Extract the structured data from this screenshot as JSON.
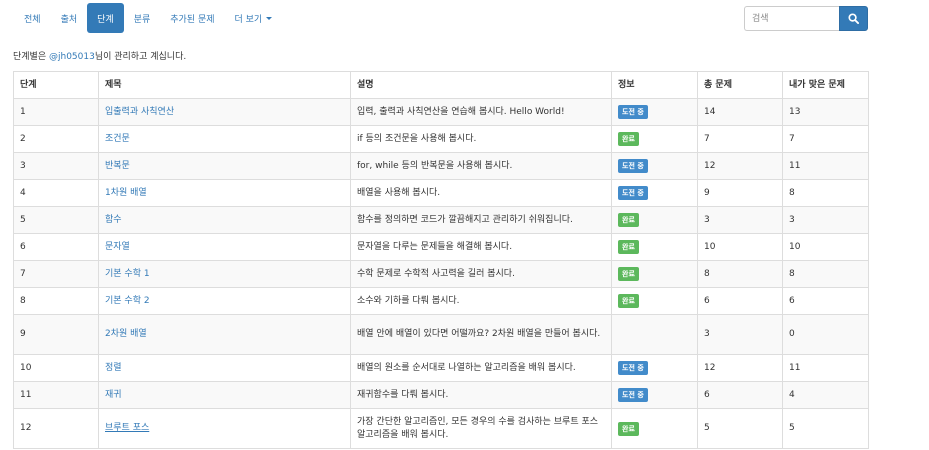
{
  "nav": {
    "items": [
      "전체",
      "출처",
      "단계",
      "분류",
      "추가된 문제",
      "더 보기"
    ]
  },
  "search": {
    "placeholder": "검색",
    "icon": "search-icon"
  },
  "subtitle": {
    "prefix": "단계별은 ",
    "user": "@jh05013",
    "suffix": "님이 관리하고 계십니다."
  },
  "colors": {
    "primary": "#337ab7",
    "in_progress": "#428bca",
    "done": "#5cb85c"
  },
  "table": {
    "headers": [
      "단계",
      "제목",
      "설명",
      "정보",
      "총 문제",
      "내가 맞은 문제"
    ],
    "rows": [
      {
        "step": "1",
        "title": "입출력과 사칙연산",
        "desc": "입력, 출력과 사칙연산을 연습해 봅시다. Hello World!",
        "status": "도전 중",
        "total": "14",
        "solved": "13"
      },
      {
        "step": "2",
        "title": "조건문",
        "desc": "if 등의 조건문을 사용해 봅시다.",
        "status": "완료",
        "total": "7",
        "solved": "7"
      },
      {
        "step": "3",
        "title": "반복문",
        "desc": "for, while 등의 반복문을 사용해 봅시다.",
        "status": "도전 중",
        "total": "12",
        "solved": "11"
      },
      {
        "step": "4",
        "title": "1차원 배열",
        "desc": "배열을 사용해 봅시다.",
        "status": "도전 중",
        "total": "9",
        "solved": "8"
      },
      {
        "step": "5",
        "title": "함수",
        "desc": "함수를 정의하면 코드가 깔끔해지고 관리하기 쉬워집니다.",
        "status": "완료",
        "total": "3",
        "solved": "3"
      },
      {
        "step": "6",
        "title": "문자열",
        "desc": "문자열을 다루는 문제들을 해결해 봅시다.",
        "status": "완료",
        "total": "10",
        "solved": "10"
      },
      {
        "step": "7",
        "title": "기본 수학 1",
        "desc": "수학 문제로 수학적 사고력을 길러 봅시다.",
        "status": "완료",
        "total": "8",
        "solved": "8"
      },
      {
        "step": "8",
        "title": "기본 수학 2",
        "desc": "소수와 기하를 다뤄 봅시다.",
        "status": "완료",
        "total": "6",
        "solved": "6"
      },
      {
        "step": "9",
        "title": "2차원 배열",
        "desc": "배열 안에 배열이 있다면 어떨까요? 2차원 배열을 만들어 봅시다.",
        "status": "",
        "total": "3",
        "solved": "0"
      },
      {
        "step": "10",
        "title": "정렬",
        "desc": "배열의 원소를 순서대로 나열하는 알고리즘을 배워 봅시다.",
        "status": "도전 중",
        "total": "12",
        "solved": "11"
      },
      {
        "step": "11",
        "title": "재귀",
        "desc": "재귀함수를 다뤄 봅시다.",
        "status": "도전 중",
        "total": "6",
        "solved": "4"
      },
      {
        "step": "12",
        "title": "브루트 포스",
        "desc": "가장 간단한 알고리즘인, 모든 경우의 수를 검사하는 브루트 포스 알고리즘을 배워 봅시다.",
        "status": "완료",
        "total": "5",
        "solved": "5"
      }
    ]
  }
}
